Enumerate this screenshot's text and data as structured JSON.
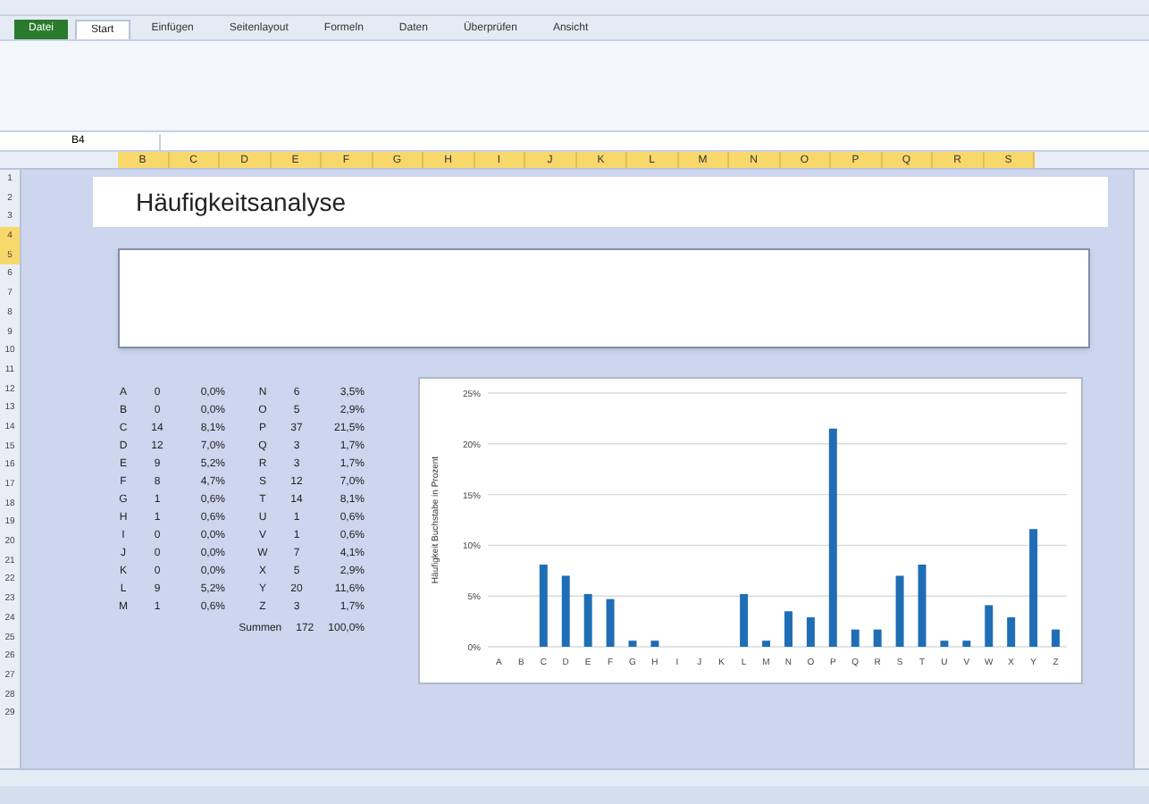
{
  "ribbon_tabs": [
    {
      "label": "Datei",
      "kind": "file",
      "selected": false
    },
    {
      "label": "Start",
      "kind": "tab",
      "selected": true
    },
    {
      "label": "Einfügen",
      "kind": "tab",
      "selected": false
    },
    {
      "label": "Seitenlayout",
      "kind": "tab",
      "selected": false
    },
    {
      "label": "Formeln",
      "kind": "tab",
      "selected": false
    },
    {
      "label": "Daten",
      "kind": "tab",
      "selected": false
    },
    {
      "label": "Überprüfen",
      "kind": "tab",
      "selected": false
    },
    {
      "label": "Ansicht",
      "kind": "tab",
      "selected": false
    }
  ],
  "name_box": {
    "value": "B4"
  },
  "column_headers": [
    "B",
    "C",
    "D",
    "E",
    "F",
    "G",
    "H",
    "I",
    "J",
    "K",
    "L",
    "M",
    "N",
    "O",
    "P",
    "Q",
    "R",
    "S"
  ],
  "row_numbers": [
    "1",
    "2",
    "3",
    "4",
    "5",
    "6",
    "7",
    "8",
    "9",
    "10",
    "11",
    "12",
    "13",
    "14",
    "15",
    "16",
    "17",
    "18",
    "19",
    "20",
    "21",
    "22",
    "23",
    "24",
    "25",
    "26",
    "27",
    "28",
    "29"
  ],
  "sheet": {
    "title": "Häufigkeitsanalyse",
    "frequency_table": [
      {
        "letter": "A",
        "count": "0",
        "percent": "0,0%"
      },
      {
        "letter": "B",
        "count": "0",
        "percent": "0,0%"
      },
      {
        "letter": "C",
        "count": "14",
        "percent": "8,1%"
      },
      {
        "letter": "D",
        "count": "12",
        "percent": "7,0%"
      },
      {
        "letter": "E",
        "count": "9",
        "percent": "5,2%"
      },
      {
        "letter": "F",
        "count": "8",
        "percent": "4,7%"
      },
      {
        "letter": "G",
        "count": "1",
        "percent": "0,6%"
      },
      {
        "letter": "H",
        "count": "1",
        "percent": "0,6%"
      },
      {
        "letter": "I",
        "count": "0",
        "percent": "0,0%"
      },
      {
        "letter": "J",
        "count": "0",
        "percent": "0,0%"
      },
      {
        "letter": "K",
        "count": "0",
        "percent": "0,0%"
      },
      {
        "letter": "L",
        "count": "9",
        "percent": "5,2%"
      },
      {
        "letter": "M",
        "count": "1",
        "percent": "0,6%"
      },
      {
        "letter": "N",
        "count": "6",
        "percent": "3,5%"
      },
      {
        "letter": "O",
        "count": "5",
        "percent": "2,9%"
      },
      {
        "letter": "P",
        "count": "37",
        "percent": "21,5%"
      },
      {
        "letter": "Q",
        "count": "3",
        "percent": "1,7%"
      },
      {
        "letter": "R",
        "count": "3",
        "percent": "1,7%"
      },
      {
        "letter": "S",
        "count": "12",
        "percent": "7,0%"
      },
      {
        "letter": "T",
        "count": "14",
        "percent": "8,1%"
      },
      {
        "letter": "U",
        "count": "1",
        "percent": "0,6%"
      },
      {
        "letter": "V",
        "count": "1",
        "percent": "0,6%"
      },
      {
        "letter": "W",
        "count": "7",
        "percent": "4,1%"
      },
      {
        "letter": "X",
        "count": "5",
        "percent": "2,9%"
      },
      {
        "letter": "Y",
        "count": "20",
        "percent": "11,6%"
      },
      {
        "letter": "Z",
        "count": "3",
        "percent": "1,7%"
      }
    ],
    "totals": {
      "label": "Summen",
      "count": "172",
      "percent": "100,0%"
    },
    "chart_data": {
      "type": "bar",
      "ylabel": "Häufigkeit Buchstabe in Prozent",
      "categories": [
        "A",
        "B",
        "C",
        "D",
        "E",
        "F",
        "G",
        "H",
        "I",
        "J",
        "K",
        "L",
        "M",
        "N",
        "O",
        "P",
        "Q",
        "R",
        "S",
        "T",
        "U",
        "V",
        "W",
        "X",
        "Y",
        "Z"
      ],
      "grid": true,
      "series": [
        {
          "color": "#1f6db5",
          "values": [
            0,
            0,
            8.1,
            7.0,
            5.2,
            4.7,
            0.6,
            0.6,
            0,
            0,
            0,
            5.2,
            0.6,
            3.5,
            2.9,
            21.5,
            1.7,
            1.7,
            7.0,
            8.1,
            0.6,
            0.6,
            4.1,
            2.9,
            11.6,
            1.7
          ]
        }
      ],
      "ylim": [
        0,
        25
      ],
      "yticks": [
        {
          "value": 0,
          "label": "0%"
        },
        {
          "value": 5,
          "label": "5%"
        },
        {
          "value": 10,
          "label": "10%"
        },
        {
          "value": 15,
          "label": "15%"
        },
        {
          "value": 20,
          "label": "20%"
        },
        {
          "value": 25,
          "label": "25%"
        }
      ]
    }
  }
}
